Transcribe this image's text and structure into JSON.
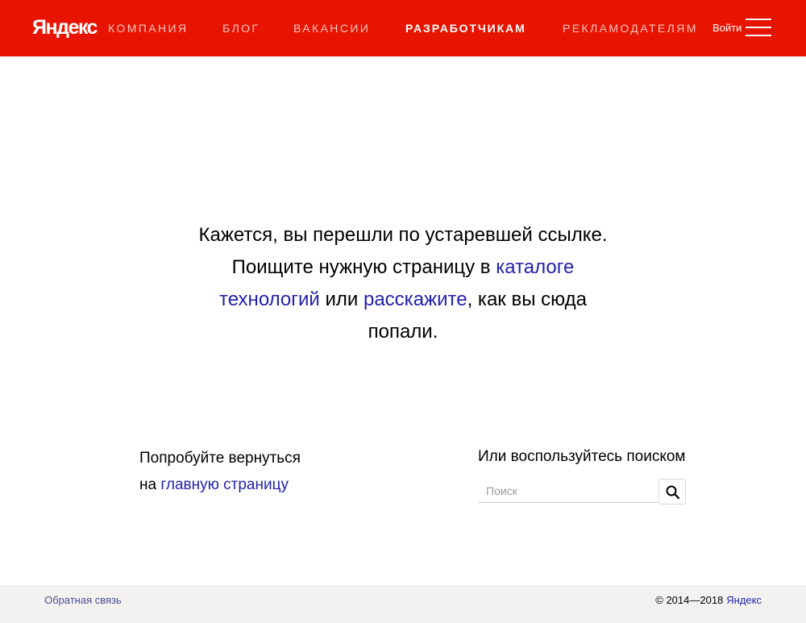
{
  "header": {
    "logo": "Яндекс",
    "nav": [
      {
        "label": "КОМПАНИЯ",
        "active": false
      },
      {
        "label": "БЛОГ",
        "active": false
      },
      {
        "label": "ВАКАНСИИ",
        "active": false
      },
      {
        "label": "РАЗРАБОТЧИКАМ",
        "active": true
      },
      {
        "label": "РЕКЛАМОДАТЕЛЯМ",
        "active": false
      }
    ],
    "login": "Войти",
    "menu_icon": "hamburger-menu-icon",
    "background_color": "#e61400"
  },
  "message": {
    "part1": "Кажется, вы перешли по устаревшей ссылке. Поищите нужную страницу в ",
    "catalog_link": "каталоге технологий",
    "part2": " или ",
    "tell_link": "расскажите",
    "part3": ", как вы сюда попали."
  },
  "back": {
    "line1": "Попробуйте вернуться",
    "prefix": "на ",
    "link": "главную страницу"
  },
  "search": {
    "title": "Или воспользуйтесь поиском",
    "placeholder": "Поиск",
    "value": "",
    "button_icon": "search-icon"
  },
  "footer": {
    "feedback": "Обратная связь",
    "copyright": "© 2014—2018",
    "brand_link": "Яндекс"
  },
  "colors": {
    "link": "#2222aa",
    "footer_bg": "#f3f2f0"
  }
}
